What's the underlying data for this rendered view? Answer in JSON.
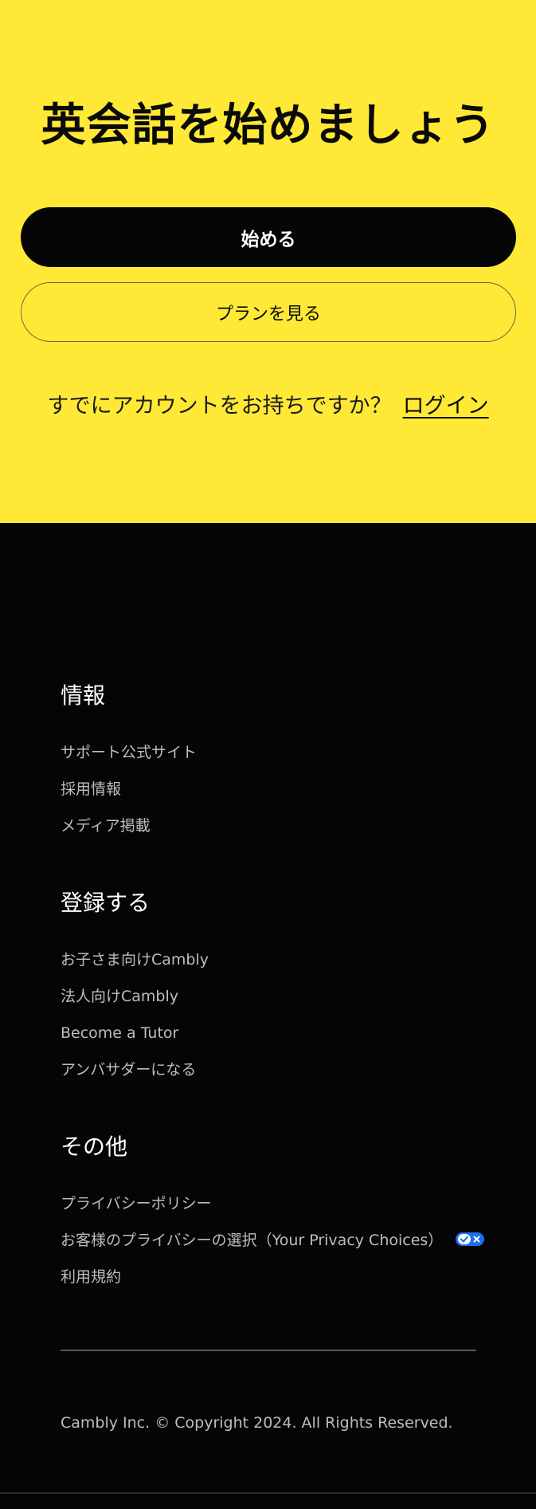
{
  "hero": {
    "title": "英会話を始めましょう",
    "start_button": "始める",
    "plans_button": "プランを見る",
    "account_prompt": "すでにアカウントをお持ちですか？",
    "login_link": "ログイン",
    "background_color": "#FFE936"
  },
  "footer": {
    "background_color": "#050505",
    "sections": [
      {
        "title": "情報",
        "links": [
          "サポート公式サイト",
          "採用情報",
          "メディア掲載"
        ]
      },
      {
        "title": "登録する",
        "links": [
          "お子さま向けCambly",
          "法人向けCambly",
          "Become a Tutor",
          "アンバサダーになる"
        ]
      },
      {
        "title": "その他",
        "links": [
          "プライバシーポリシー",
          "お客様のプライバシーの選択（Your Privacy Choices）",
          "利用規約"
        ]
      }
    ],
    "privacy_icon": "privacy-choices-toggle-icon",
    "privacy_icon_color": "#1A6EF2",
    "copyright": "Cambly Inc. © Copyright 2024. All Rights Reserved."
  }
}
